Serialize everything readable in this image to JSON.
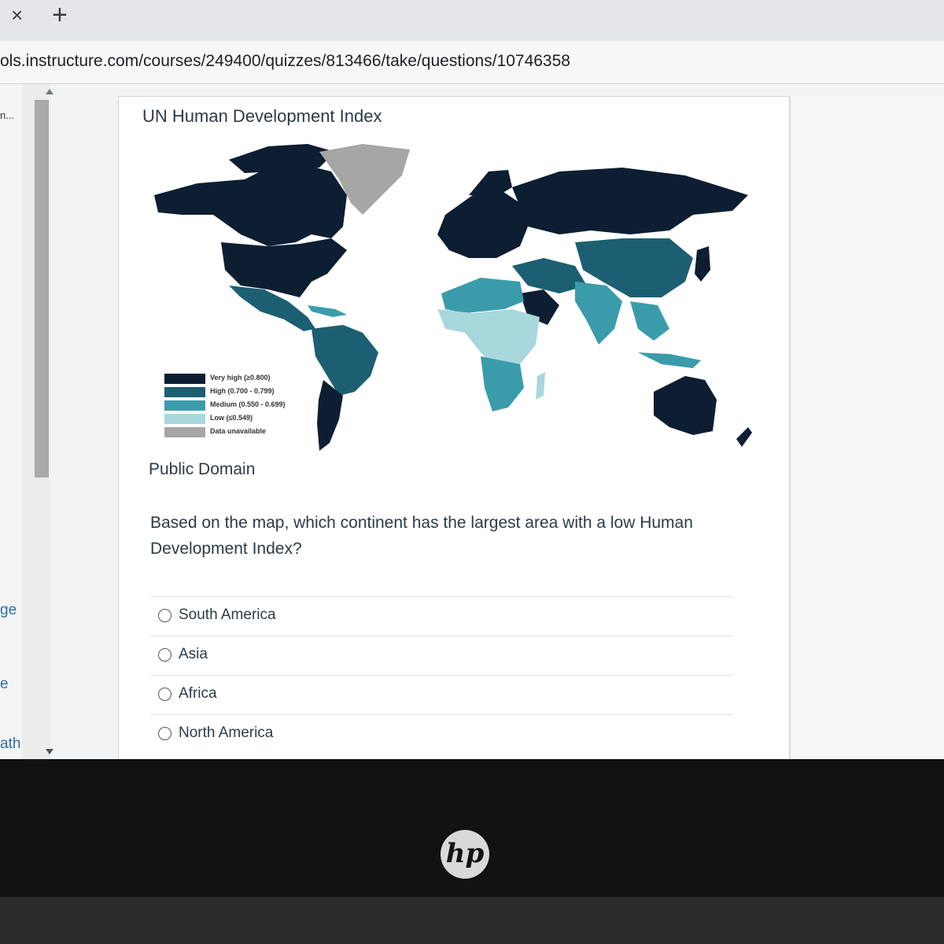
{
  "browser": {
    "close_tab_glyph": "×",
    "new_tab_glyph": "+",
    "url": "ols.instructure.com/courses/249400/quizzes/813466/take/questions/10746358"
  },
  "left_nav": {
    "items": [
      "n...",
      "ge",
      "e",
      "ath"
    ]
  },
  "map": {
    "title": "UN Human Development Index",
    "legend": [
      {
        "label": "Very high (≥0.800)",
        "color": "#0d1e33"
      },
      {
        "label": "High (0.700 - 0.799)",
        "color": "#1d5f72"
      },
      {
        "label": "Medium (0.550 - 0.699)",
        "color": "#3a9cab"
      },
      {
        "label": "Low (≤0.549)",
        "color": "#a8d8dc"
      },
      {
        "label": "Data unavailable",
        "color": "#a6a6a6"
      }
    ],
    "credit": "Public Domain"
  },
  "question": {
    "text": "Based on the map, which continent has the largest area with a low Human Development Index?",
    "answers": [
      "South America",
      "Asia",
      "Africa",
      "North America"
    ]
  },
  "device": {
    "logo_text": "hp"
  }
}
